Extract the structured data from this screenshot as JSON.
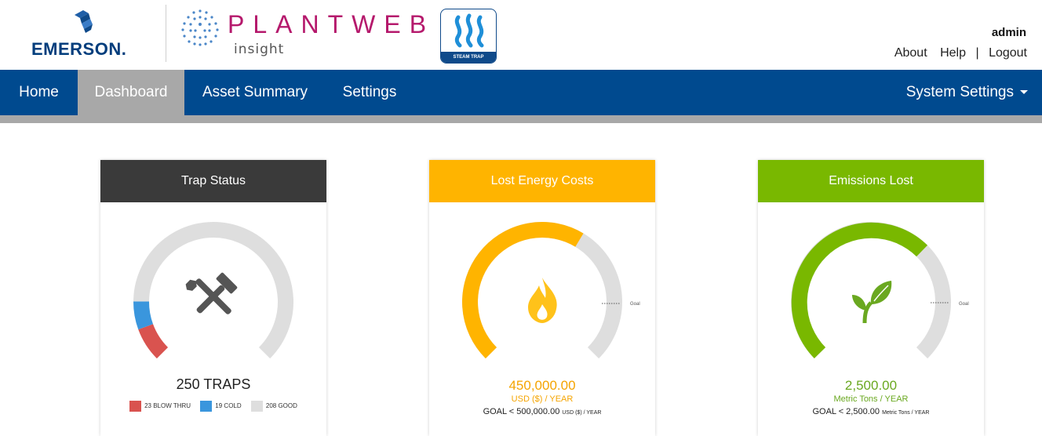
{
  "header": {
    "emerson_logo_text": "EMERSON.",
    "plantweb_title": "PLANTWEB",
    "plantweb_subtitle": "insight",
    "badge_text": "STEAM TRAP",
    "username": "admin",
    "links": [
      "About",
      "Help",
      "Logout"
    ],
    "link_separator": "|"
  },
  "nav": {
    "items": [
      "Home",
      "Dashboard",
      "Asset Summary",
      "Settings"
    ],
    "active": "Dashboard",
    "system_settings": "System Settings"
  },
  "cards": {
    "trap_status": {
      "title": "Trap Status",
      "header_color": "#3a3a3a",
      "total_label": "250 TRAPS",
      "segments": [
        {
          "label": "23 BLOW THRU",
          "value": 23,
          "color": "#d9534f"
        },
        {
          "label": "19 COLD",
          "value": 19,
          "color": "#3a96dd"
        },
        {
          "label": "208 GOOD",
          "value": 208,
          "color": "#dedede"
        }
      ],
      "icon": "tools-icon"
    },
    "lost_energy": {
      "title": "Lost Energy Costs",
      "header_color": "#ffb400",
      "value": "450,000.00",
      "unit": "USD ($) / YEAR",
      "goal_prefix": "GOAL < 500,000.00",
      "goal_unit": "USD ($) / YEAR",
      "goal_marker": "Goal",
      "fraction": 0.9,
      "icon": "flame-icon"
    },
    "emissions_lost": {
      "title": "Emissions Lost",
      "header_color": "#79b800",
      "value": "2,500.00",
      "unit": "Metric Tons / YEAR",
      "goal_prefix": "GOAL < 2,500.00",
      "goal_unit": "Metric Tons / YEAR",
      "goal_marker": "Goal",
      "fraction": 1.0,
      "icon": "leaf-icon"
    }
  }
}
